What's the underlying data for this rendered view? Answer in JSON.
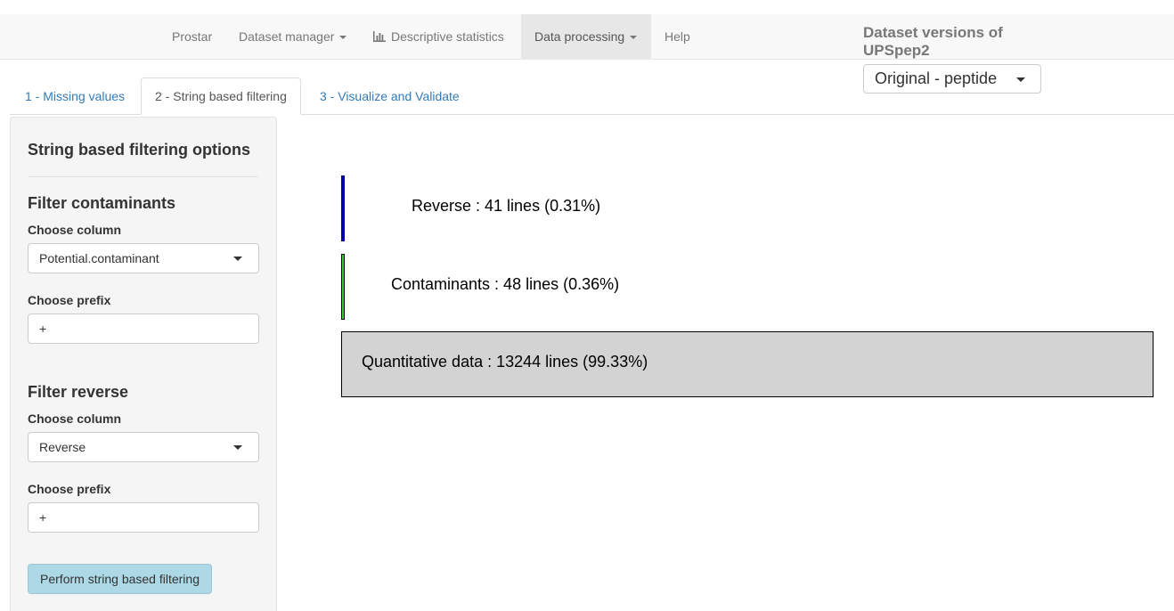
{
  "navbar": {
    "items": [
      {
        "label": "Prostar"
      },
      {
        "label": "Dataset manager"
      },
      {
        "label": "Descriptive statistics",
        "icon": "bar-chart-icon"
      },
      {
        "label": "Data processing"
      },
      {
        "label": "Help"
      }
    ]
  },
  "dataset_panel": {
    "title": "Dataset versions of UPSpep2",
    "selected_version": "Original - peptide"
  },
  "tabs": [
    {
      "label": "1 - Missing values"
    },
    {
      "label": "2 - String based filtering"
    },
    {
      "label": "3 - Visualize and Validate"
    }
  ],
  "sidebar": {
    "title": "String based filtering options",
    "contaminants": {
      "heading": "Filter contaminants",
      "column_label": "Choose column",
      "column_value": "Potential.contaminant",
      "prefix_label": "Choose prefix",
      "prefix_value": "+"
    },
    "reverse": {
      "heading": "Filter reverse",
      "column_label": "Choose column",
      "column_value": "Reverse",
      "prefix_label": "Choose prefix",
      "prefix_value": "+"
    },
    "perform_button": "Perform string based filtering"
  },
  "filter_summary": {
    "reverse_label": "Reverse : 41 lines (0.31%)",
    "contaminants_label": "Contaminants : 48 lines (0.36%)",
    "quantitative_label": "Quantitative data : 13244 lines (99.33%)",
    "colors": {
      "reverse": "#0000a0",
      "contaminants": "#33cc33",
      "quantitative": "#d3d3d3"
    }
  }
}
